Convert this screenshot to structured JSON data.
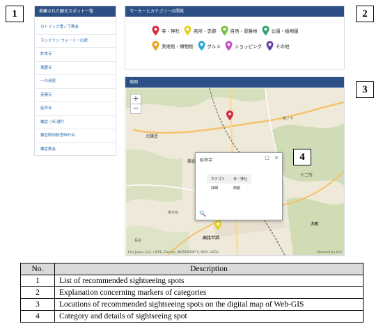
{
  "callouts": [
    "1",
    "2",
    "3",
    "4"
  ],
  "sidebar": {
    "title": "推薦された観光スポット一覧",
    "items": [
      "カトリック雪ノ下教会",
      "ラングドン ウォーナーの碑",
      "妙本寺",
      "東慶寺",
      "一の鳥居",
      "英勝寺",
      "延命寺",
      "鎌倉 小町通り",
      "鎌倉駅旧駅舎時計台",
      "鎌倉教会"
    ]
  },
  "legend": {
    "title": "マーカーとカテゴリーの関係",
    "items": [
      {
        "label": "寺・神社",
        "color": "#d7263d"
      },
      {
        "label": "名所・史跡",
        "color": "#e4d322"
      },
      {
        "label": "自然・景勝地",
        "color": "#7fbf3f"
      },
      {
        "label": "公園・植物園",
        "color": "#2fa36b"
      },
      {
        "label": "美術館・博物館",
        "color": "#e9a21f"
      },
      {
        "label": "グルメ",
        "color": "#2ba9d6"
      },
      {
        "label": "ショッピング",
        "color": "#c94fc9"
      },
      {
        "label": "その他",
        "color": "#6a3fa8"
      }
    ]
  },
  "map": {
    "title": "地図",
    "zoom_in": "+",
    "zoom_out": "−",
    "attribution": "Esri Japan, Esri, HERE, Garmin, INCREMENT P, NGA, USGS",
    "powered_by": "Powered by Esri",
    "place_labels": [
      "北鎌倉",
      "十二所",
      "大町",
      "鎌倉",
      "由比ガ浜",
      "扇ガ谷",
      "雪ノ下",
      "長谷"
    ]
  },
  "popup": {
    "title": "延命寺",
    "maximize_icon": "□",
    "close_icon": "×",
    "rows": [
      {
        "key": "カテゴリ",
        "value": "寺・神社"
      },
      {
        "key": "詳細",
        "value": "映動"
      }
    ],
    "zoom_icon": "🔍"
  },
  "description": {
    "headers": [
      "No.",
      "Description"
    ],
    "rows": [
      {
        "no": "1",
        "text": "List of recommended sightseeing spots"
      },
      {
        "no": "2",
        "text": "Explanation concerning markers of categories"
      },
      {
        "no": "3",
        "text": "Locations of recommended sightseeing spots on the digital map of Web-GIS"
      },
      {
        "no": "4",
        "text": "Category and details of sightseeing spot"
      }
    ]
  }
}
